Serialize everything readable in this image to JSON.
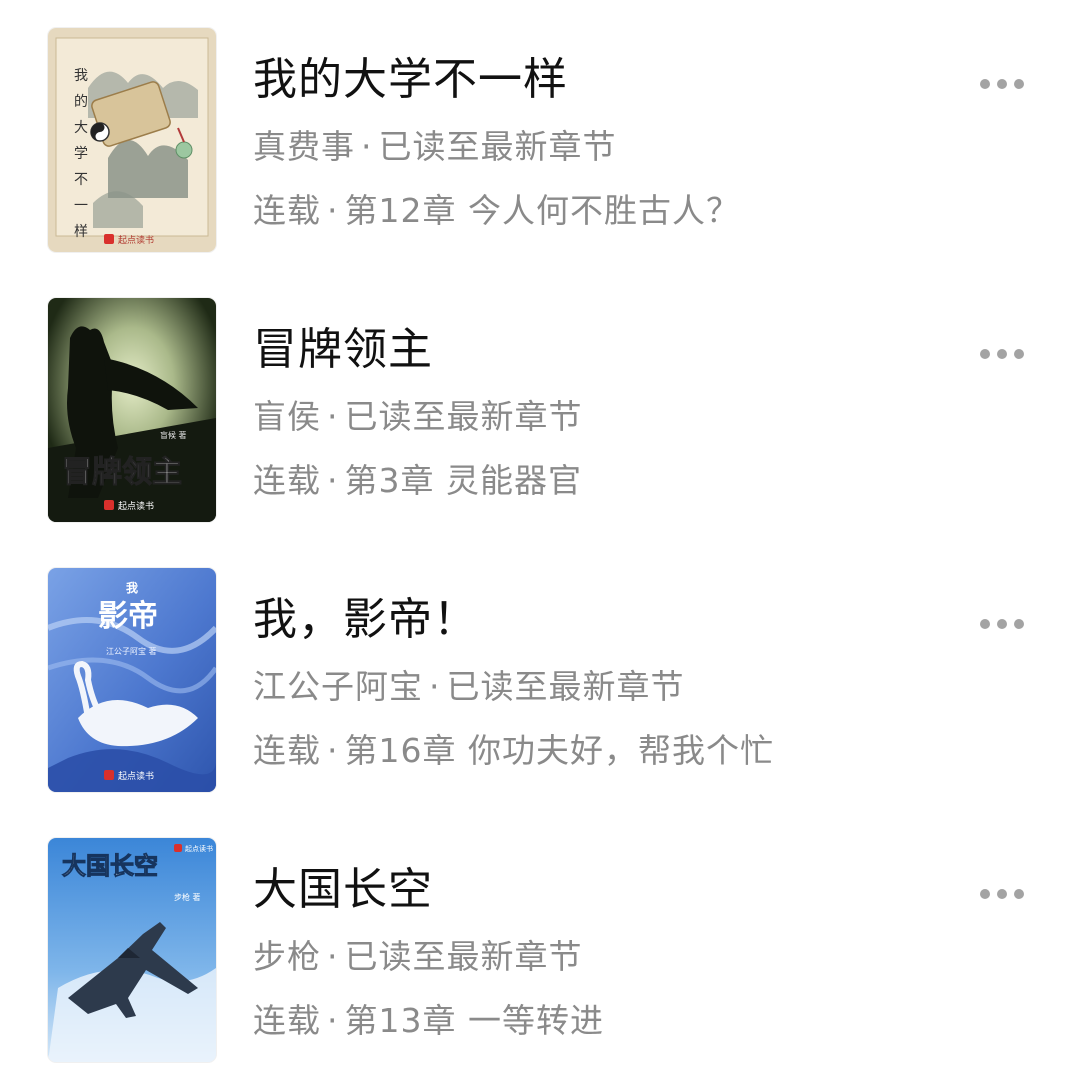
{
  "books": [
    {
      "title": "我的大学不一样",
      "author": "真费事",
      "progress": "已读至最新章节",
      "status": "连载",
      "chapter": "第12章 今人何不胜古人？",
      "cover": {
        "vertical_title": "我的大学不一样",
        "publisher": "起点读书",
        "theme": "parchment-scroll",
        "bg": "#e9dcc3"
      }
    },
    {
      "title": "冒牌领主",
      "author": "盲侯",
      "progress": "已读至最新章节",
      "status": "连载",
      "chapter": "第3章 灵能器官",
      "cover": {
        "cover_title": "冒牌领主",
        "cover_author": "盲候 著",
        "publisher": "起点读书",
        "theme": "dark-moon-knight",
        "bg": "#2c3a1f"
      }
    },
    {
      "title": "我，影帝！",
      "author": "江公子阿宝",
      "progress": "已读至最新章节",
      "status": "连载",
      "chapter": "第16章 你功夫好，帮我个忙",
      "cover": {
        "cover_title_small": "我",
        "cover_title": "影帝",
        "cover_author": "江公子阿宝 著",
        "publisher": "起点读书",
        "theme": "blue-swan",
        "bg": "#5b84d6"
      }
    },
    {
      "title": "大国长空",
      "author": "步枪",
      "progress": "已读至最新章节",
      "status": "连载",
      "chapter": "第13章 一等转进",
      "cover": {
        "cover_title": "大国长空",
        "cover_author": "步枪 著",
        "publisher": "起点读书",
        "theme": "sky-fighter-jet",
        "bg": "#4a8fd6"
      }
    }
  ],
  "separator": "·",
  "more_icon": "more-horizontal-icon",
  "colors": {
    "title": "#111111",
    "meta": "#8a8a8a",
    "more_dots": "#a3a3a3"
  }
}
